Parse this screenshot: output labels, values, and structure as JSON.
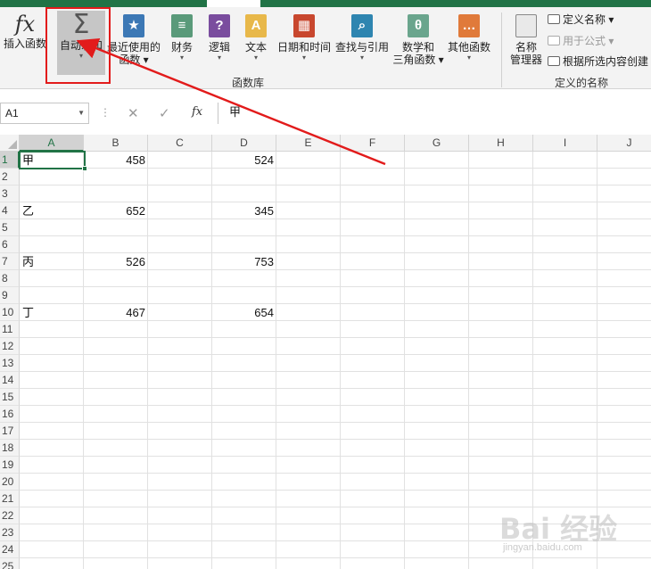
{
  "ribbon": {
    "insert_function": "插入函数",
    "autosum": "自动求和",
    "recent_line1": "最近使用的",
    "recent_line2": "函数",
    "financial": "财务",
    "logical": "逻辑",
    "text": "文本",
    "datetime": "日期和时间",
    "lookup": "查找与引用",
    "math_line1": "数学和",
    "math_line2": "三角函数",
    "more": "其他函数",
    "library_label": "函数库",
    "name_manager_line1": "名称",
    "name_manager_line2": "管理器",
    "define_name": "定义名称",
    "use_in_formula": "用于公式",
    "create_from_selection": "根据所选内容创建",
    "defined_names_label": "定义的名称",
    "icons": {
      "insert_function": "fx-icon",
      "autosum": "sigma-icon",
      "recent": "star-icon",
      "financial": "coins-icon",
      "logical": "question-icon",
      "text": "letter-a-icon",
      "datetime": "calendar-icon",
      "lookup": "magnifier-icon",
      "math": "theta-icon",
      "more": "ellipsis-icon"
    }
  },
  "formula_bar": {
    "name_box": "A1",
    "fx": "fx",
    "cancel": "✕",
    "enter": "✓",
    "content": "甲"
  },
  "grid": {
    "columns": [
      "A",
      "B",
      "C",
      "D",
      "E",
      "F",
      "G",
      "H",
      "I",
      "J"
    ],
    "rows": [
      "1",
      "2",
      "3",
      "4",
      "5",
      "6",
      "7",
      "8",
      "9",
      "10",
      "11",
      "12",
      "13",
      "14",
      "15",
      "16",
      "17",
      "18",
      "19",
      "20",
      "21",
      "22",
      "23",
      "24",
      "25"
    ],
    "selected_cell": "A1",
    "cells": [
      {
        "ref": "A1",
        "value": "甲"
      },
      {
        "ref": "B1",
        "value": "458"
      },
      {
        "ref": "D1",
        "value": "524"
      },
      {
        "ref": "A4",
        "value": "乙"
      },
      {
        "ref": "B4",
        "value": "652"
      },
      {
        "ref": "D4",
        "value": "345"
      },
      {
        "ref": "A7",
        "value": "丙"
      },
      {
        "ref": "B7",
        "value": "526"
      },
      {
        "ref": "D7",
        "value": "753"
      },
      {
        "ref": "A10",
        "value": "丁"
      },
      {
        "ref": "B10",
        "value": "467"
      },
      {
        "ref": "D10",
        "value": "654"
      }
    ]
  },
  "watermark": {
    "brand": "Bai 经验",
    "url": "jingyan.baidu.com"
  },
  "colors": {
    "accent": "#217346",
    "annotation": "#e21b1b"
  }
}
